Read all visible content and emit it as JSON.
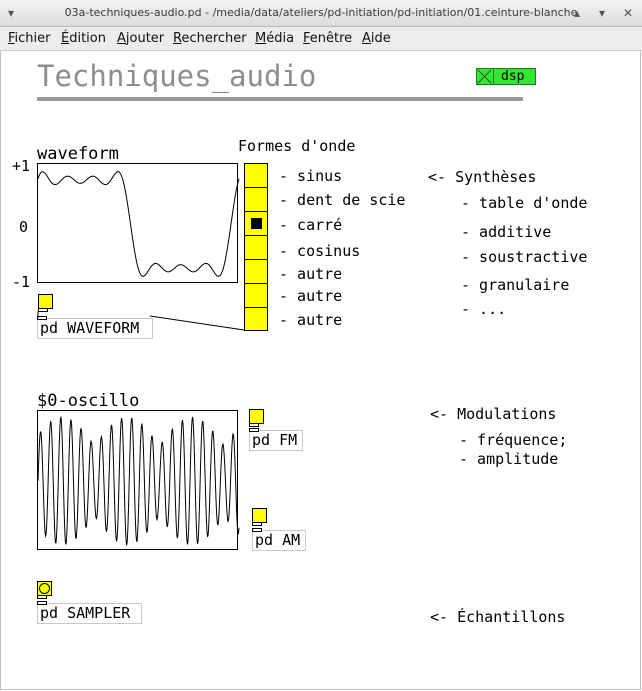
{
  "window": {
    "title": "03a-techniques-audio.pd  - /media/data/ateliers/pd-initiation/pd-initiation/01.ceinture-blanche"
  },
  "menu": [
    "Fichier",
    "Édition",
    "Ajouter",
    "Rechercher",
    "Média",
    "Fenêtre",
    "Aide"
  ],
  "patch": {
    "title": "Techniques_audio",
    "dsp_label": "dsp",
    "waveform": {
      "name": "waveform",
      "y_labels": [
        "+1",
        "0",
        "-1"
      ],
      "object": "pd WAVEFORM"
    },
    "formes": {
      "heading": "Formes d'onde",
      "options": [
        "- sinus",
        "- dent de scie",
        "- carré",
        "- cosinus",
        "- autre",
        "- autre",
        "- autre"
      ],
      "selected_index": 2
    },
    "syntheses": {
      "heading": "<- Synthèses",
      "items": [
        "- table d'onde",
        "- additive",
        "- soustractive",
        "- granulaire",
        "- ..."
      ]
    },
    "oscillo": {
      "name": "$0-oscillo",
      "fm_object": "pd FM",
      "am_object": "pd AM"
    },
    "modulations": {
      "heading": "<- Modulations",
      "items": [
        "- fréquence;",
        "- amplitude"
      ]
    },
    "sampler": {
      "object": "pd SAMPLER",
      "comment": "<- Échantillons"
    }
  },
  "colors": {
    "gui_yellow": "#ffff00",
    "dsp_green": "#33e633",
    "title_grey": "#8e8e8e"
  }
}
